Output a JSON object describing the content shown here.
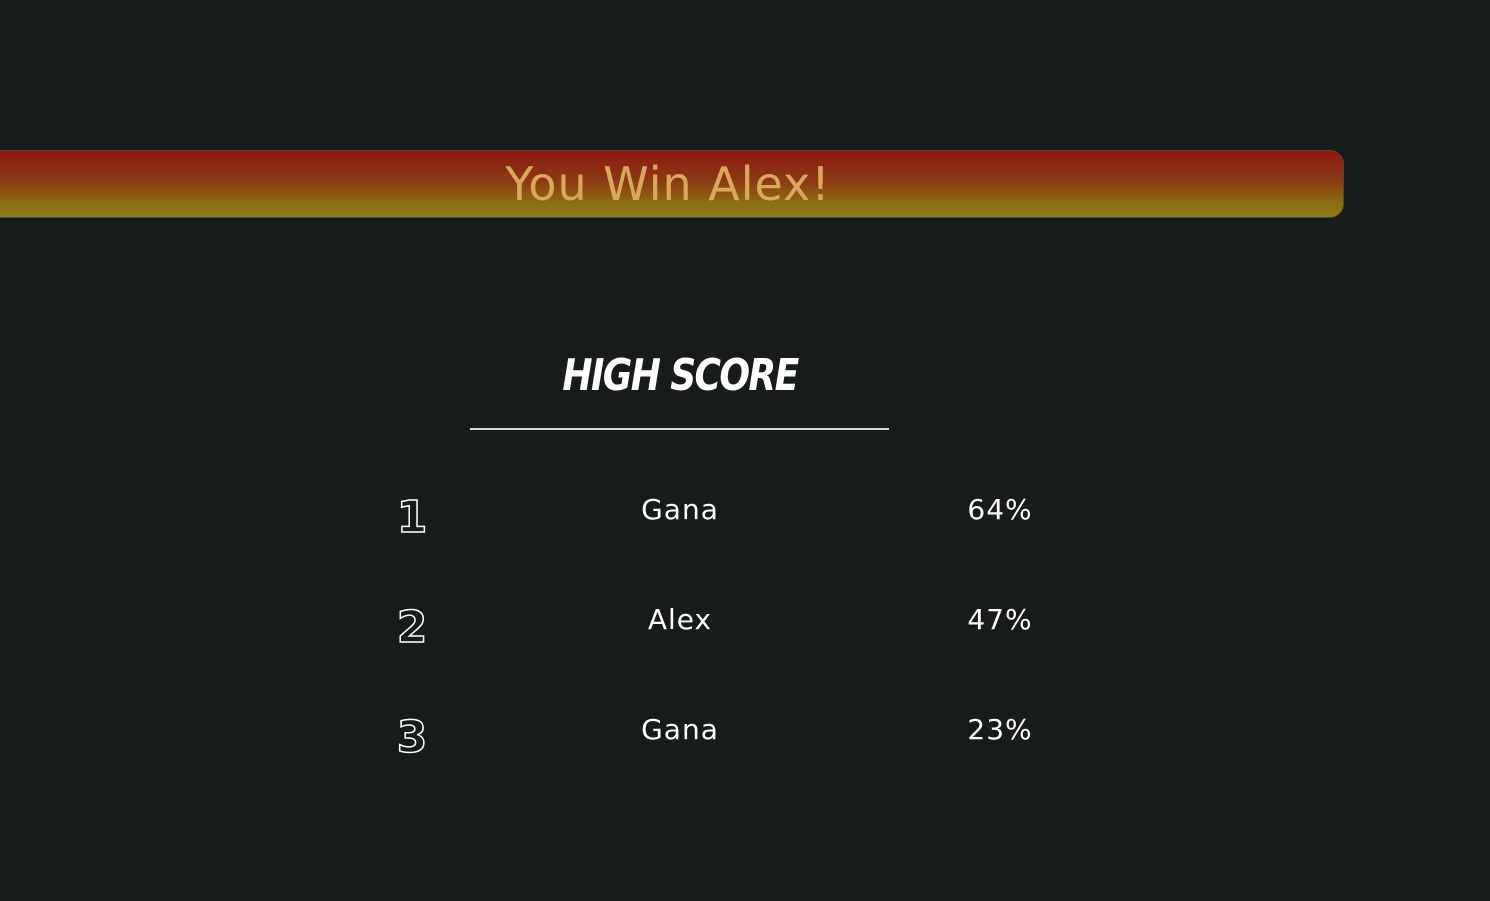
{
  "banner": {
    "text": "You Win Alex!"
  },
  "highscore": {
    "title": "HIGH SCORE",
    "entries": [
      {
        "rank": "1",
        "name": "Gana",
        "score": "64%"
      },
      {
        "rank": "2",
        "name": "Alex",
        "score": "47%"
      },
      {
        "rank": "3",
        "name": "Gana",
        "score": "23%"
      }
    ]
  },
  "colors": {
    "background": "#181b1b",
    "banner_top": "#921713",
    "banner_bottom": "#8a7a14",
    "banner_text": "#dba65f",
    "text": "#ffffff"
  }
}
